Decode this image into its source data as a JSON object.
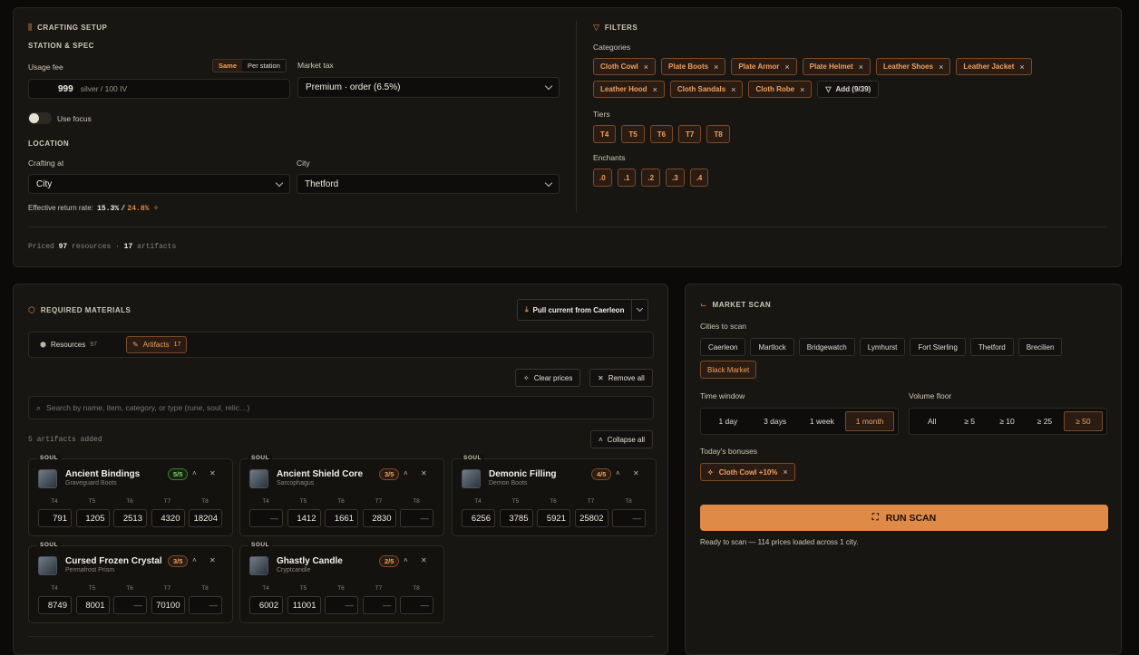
{
  "setup": {
    "title": "CRAFTING SETUP",
    "station_spec": "STATION & SPEC",
    "usage_fee_label": "Usage fee",
    "fee_toggle": [
      "Same",
      "Per station"
    ],
    "fee_value": "999",
    "fee_unit": "silver / 100 IV",
    "market_tax_label": "Market tax",
    "market_tax_value": "Premium · order (6.5%)",
    "use_focus_label": "Use focus",
    "location": "LOCATION",
    "crafting_at_label": "Crafting at",
    "crafting_at_value": "City",
    "city_label": "City",
    "city_value": "Thetford",
    "return_rate_label": "Effective return rate:",
    "return_rate_a": "15.3%",
    "return_sep": "/",
    "return_rate_b": "24.8%",
    "priced_prefix": "Priced",
    "priced_resources": "97",
    "priced_mid": "resources ·",
    "priced_artifacts": "17",
    "priced_suffix": "artifacts"
  },
  "filters": {
    "title": "FILTERS",
    "categories_label": "Categories",
    "categories": [
      "Cloth Cowl",
      "Plate Boots",
      "Plate Armor",
      "Plate Helmet",
      "Leather Shoes",
      "Leather Jacket",
      "Leather Hood",
      "Cloth Sandals",
      "Cloth Robe"
    ],
    "add_label": "Add (9/39)",
    "tiers_label": "Tiers",
    "tiers": [
      "T4",
      "T5",
      "T6",
      "T7",
      "T8"
    ],
    "enchants_label": "Enchants",
    "enchants": [
      ".0",
      ".1",
      ".2",
      ".3",
      ".4"
    ]
  },
  "materials": {
    "title": "REQUIRED MATERIALS",
    "pull_label": "Pull current from Caerleon",
    "tab_resources": "Resources",
    "tab_resources_count": "97",
    "tab_artifacts": "Artifacts",
    "tab_artifacts_count": "17",
    "clear_prices": "Clear prices",
    "remove_all": "Remove all",
    "search_placeholder": "Search by name, item, category, or type (rune, soul, relic…)",
    "added_text": "5 artifacts added",
    "collapse_all": "Collapse all",
    "tier_labels": [
      "T4",
      "T5",
      "T6",
      "T7",
      "T8"
    ],
    "cards": [
      {
        "tag": "SOUL",
        "name": "Ancient Bindings",
        "sub": "Graveguard Boots",
        "count": "5/5",
        "prices": [
          "791",
          "1205",
          "2513",
          "4320",
          "18204"
        ]
      },
      {
        "tag": "SOUL",
        "name": "Ancient Shield Core",
        "sub": "Sarcophagus",
        "count": "3/5",
        "prices": [
          "—",
          "1412",
          "1661",
          "2830",
          "—"
        ]
      },
      {
        "tag": "SOUL",
        "name": "Demonic Filling",
        "sub": "Demon Boots",
        "count": "4/5",
        "prices": [
          "6256",
          "3785",
          "5921",
          "25802",
          "—"
        ]
      },
      {
        "tag": "SOUL",
        "name": "Cursed Frozen Crystal",
        "sub": "Permafrost Prism",
        "count": "3/5",
        "prices": [
          "8749",
          "8001",
          "—",
          "70100",
          "—"
        ]
      },
      {
        "tag": "SOUL",
        "name": "Ghastly Candle",
        "sub": "Cryptcandle",
        "count": "2/5",
        "prices": [
          "6002",
          "11001",
          "—",
          "—",
          "—"
        ]
      }
    ]
  },
  "scan": {
    "title": "MARKET SCAN",
    "cities_label": "Cities to scan",
    "cities": [
      "Caerleon",
      "Martlock",
      "Bridgewatch",
      "Lymhurst",
      "Fort Sterling",
      "Thetford",
      "Brecilien"
    ],
    "black_market": "Black Market",
    "time_label": "Time window",
    "time_options": [
      "1 day",
      "3 days",
      "1 week",
      "1 month"
    ],
    "volume_label": "Volume floor",
    "volume_options": [
      "All",
      "≥ 5",
      "≥ 10",
      "≥ 25",
      "≥ 50"
    ],
    "bonus_label": "Today's bonuses",
    "bonus_chip": "Cloth Cowl +10%",
    "run_label": "RUN SCAN",
    "status": "Ready to scan — 114 prices loaded across 1 city."
  },
  "colors": {
    "accent": "#e08a48",
    "panel": "#181612",
    "good": "#7bd06a"
  }
}
